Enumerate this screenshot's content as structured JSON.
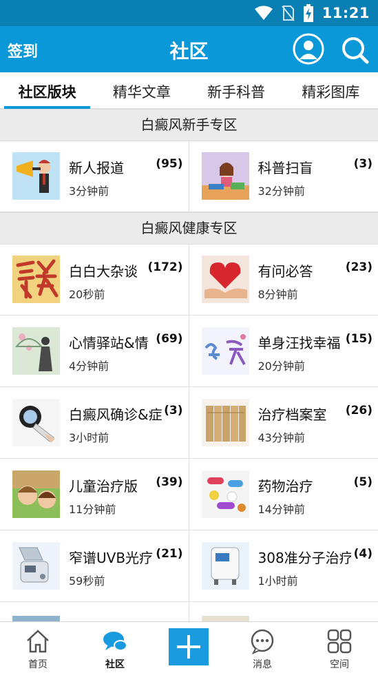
{
  "status_bar": {
    "time": "11:21"
  },
  "header": {
    "checkin_label": "签到",
    "title": "社区"
  },
  "tabs": [
    {
      "label": "社区版块",
      "active": true
    },
    {
      "label": "精华文章",
      "active": false
    },
    {
      "label": "新手科普",
      "active": false
    },
    {
      "label": "精彩图库",
      "active": false
    }
  ],
  "sections": [
    {
      "title": "白癜风新手专区",
      "boards": [
        {
          "name": "新人报道",
          "count": "(95)",
          "time": "3分钟前",
          "thumb": "megaphone-man"
        },
        {
          "name": "科普扫盲",
          "count": "(3)",
          "time": "32分钟前",
          "thumb": "girl-reading"
        }
      ]
    },
    {
      "title": "白癜风健康专区",
      "boards": [
        {
          "name": "白白大杂谈",
          "count": "(172)",
          "time": "20秒前",
          "thumb": "calligraphy-tan"
        },
        {
          "name": "有问必答",
          "count": "(23)",
          "time": "8分钟前",
          "thumb": "heart-in-hands"
        },
        {
          "name": "心情驿站&情",
          "count": "(69)",
          "time": "4分钟前",
          "thumb": "umbrella-woman"
        },
        {
          "name": "单身汪找幸福",
          "count": "(15)",
          "time": "20分钟前",
          "thumb": "yuanfen-text"
        },
        {
          "name": "白癜风确诊&症",
          "count": "(3)",
          "time": "3小时前",
          "thumb": "wood-lamp"
        },
        {
          "name": "治疗档案室",
          "count": "(26)",
          "time": "43分钟前",
          "thumb": "file-folders"
        },
        {
          "name": "儿童治疗版",
          "count": "(39)",
          "time": "11分钟前",
          "thumb": "children-faces"
        },
        {
          "name": "药物治疗",
          "count": "(5)",
          "time": "14分钟前",
          "thumb": "pills"
        },
        {
          "name": "窄谱UVB光疗",
          "count": "(21)",
          "time": "59秒前",
          "thumb": "uvb-lamp"
        },
        {
          "name": "308准分子治疗",
          "count": "(4)",
          "time": "1小时前",
          "thumb": "excimer-machine"
        }
      ]
    }
  ],
  "bottom_nav": [
    {
      "label": "首页",
      "icon": "home-icon",
      "active": false
    },
    {
      "label": "社区",
      "icon": "chat-bubbles-icon",
      "active": true
    },
    {
      "label": "",
      "icon": "plus-icon",
      "active": false
    },
    {
      "label": "消息",
      "icon": "message-icon",
      "active": false
    },
    {
      "label": "空间",
      "icon": "grid-icon",
      "active": false
    }
  ],
  "colors": {
    "header_bg": "#0b98d9",
    "status_bg": "#0a7fb4",
    "accent": "#0b98d9",
    "section_bg": "#ebebeb"
  }
}
